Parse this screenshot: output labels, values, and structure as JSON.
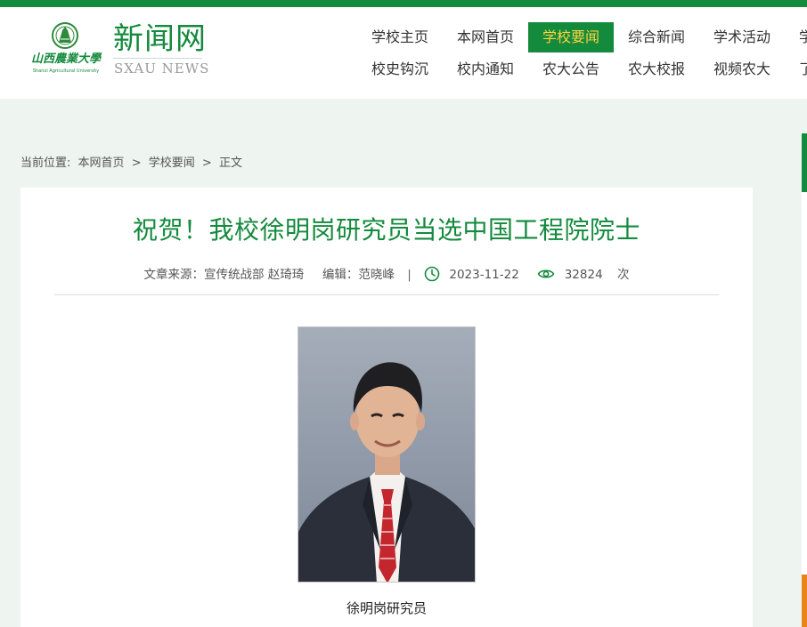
{
  "header": {
    "logo_text": "山西农业大学",
    "logo_sub": "Shanxi Agricultural University",
    "site_name": "新闻网",
    "site_sub": "SXAU NEWS"
  },
  "nav": {
    "row1": [
      "学校主页",
      "本网首页",
      "学校要闻",
      "综合新闻",
      "学术活动",
      "学"
    ],
    "row2": [
      "校史钩沉",
      "校内通知",
      "农大公告",
      "农大校报",
      "视频农大",
      "了"
    ],
    "active": "学校要闻"
  },
  "breadcrumb": {
    "prefix": "当前位置:",
    "items": [
      "本网首页",
      "学校要闻",
      "正文"
    ],
    "separator": ">"
  },
  "article": {
    "title": "祝贺！我校徐明岗研究员当选中国工程院院士",
    "source": "文章来源：宣传统战部 赵琦琦",
    "editor": "编辑：范晓峰",
    "date": "2023-11-22",
    "views": "32824",
    "views_unit": "次",
    "photo_caption": "徐明岗研究员"
  },
  "colors": {
    "brand_green": "#138a3c",
    "active_text": "#ffd33d",
    "accent_orange": "#e8841a"
  }
}
